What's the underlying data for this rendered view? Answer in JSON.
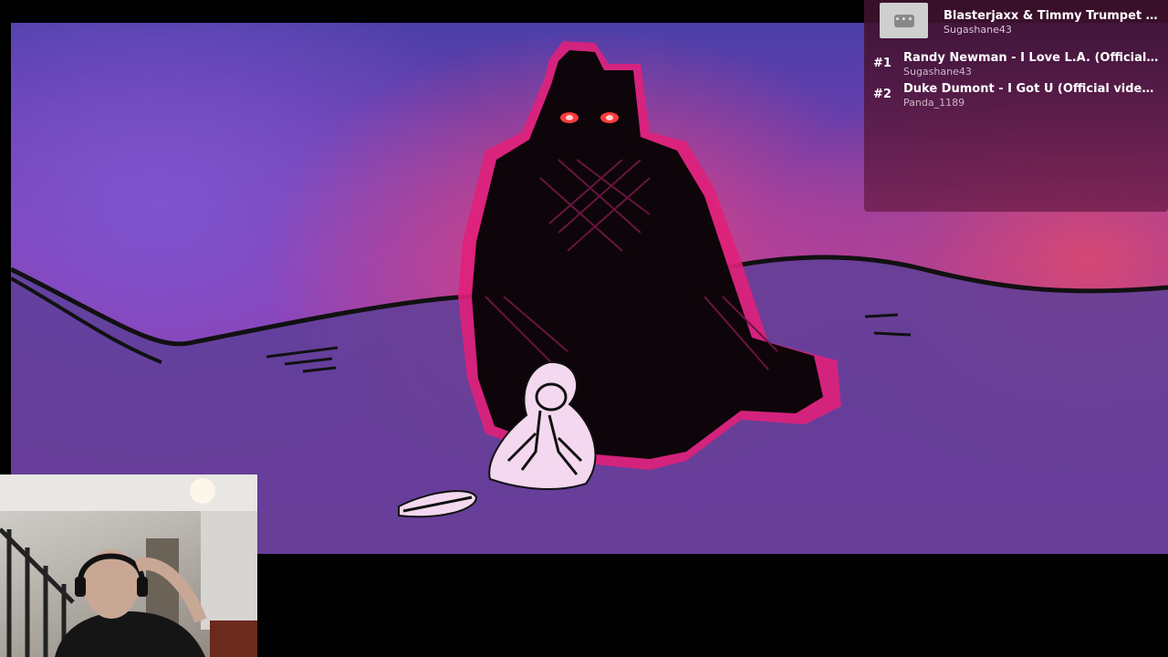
{
  "now_playing": {
    "title": "Blasterjaxx & Timmy Trumpet - Narco...",
    "user": "Sugashane43",
    "menu_label": "•••"
  },
  "queue": [
    {
      "number": "#1",
      "title": "Randy Newman - I Love L.A. (Official Video) [...",
      "user": "Sugashane43"
    },
    {
      "number": "#2",
      "title": "Duke Dumont - I Got U (Official video) ft. Jax ...",
      "user": "Panda_1189"
    }
  ],
  "colors": {
    "queue_text": "#ffffff",
    "queue_user": "#d9c6d4",
    "monster_glow": "#e0207a",
    "eyes": "#ff3b3b"
  },
  "icons": {
    "menu": "more-dots-icon"
  }
}
